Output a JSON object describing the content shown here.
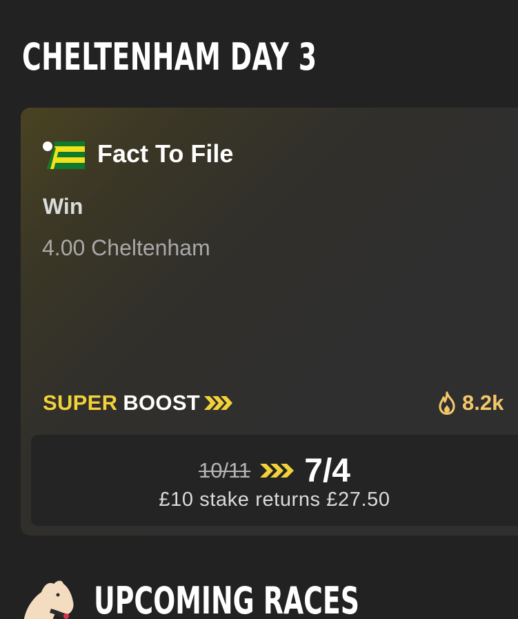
{
  "page": {
    "heading": "CHELTENHAM DAY 3"
  },
  "boost_card": {
    "runner": "Fact To File",
    "market": "Win",
    "event": "4.00 Cheltenham",
    "boost_super": "SUPER",
    "boost_word": "BOOST",
    "popularity": "8.2k",
    "old_odds": "10/11",
    "new_odds": "7/4",
    "returns_text": "£10 stake returns £27.50",
    "icons": {
      "silks": "jockey-silks-icon",
      "chevrons": "triple-chevron-icon",
      "popularity": "flame-icon"
    }
  },
  "upcoming": {
    "title": "UPCOMING RACES",
    "icon": "horse-head-icon"
  },
  "colors": {
    "background": "#222222",
    "accent_yellow": "#f2d13a",
    "popularity": "#f4c66a",
    "silks_green": "#0f7a2b",
    "silks_yellow": "#f3e11b"
  }
}
